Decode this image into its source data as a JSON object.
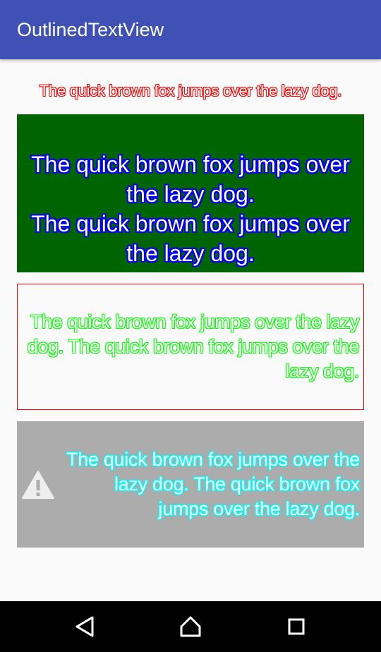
{
  "app": {
    "title": "OutlinedTextView"
  },
  "samples": {
    "red_outline": {
      "text": "The quick brown fox jumps over the lazy dog.",
      "outline_color": "#ff0000",
      "fill_color": "#ffffff"
    },
    "blue_outline_on_green": {
      "text": "The quick brown fox jumps over the lazy dog.\nThe quick brown fox jumps over the lazy dog.",
      "background_color": "#006400",
      "outline_color": "#0000ee",
      "fill_color": "#ffffff"
    },
    "green_outline_bordered": {
      "text": "The quick brown fox jumps over the lazy dog. The quick brown fox jumps over the lazy dog.",
      "border_color": "#ff0000",
      "outline_color": "#00ff00",
      "fill_color": "#ffffff"
    },
    "cyan_glow_with_icon": {
      "icon": "warning-icon",
      "text": "The quick brown fox jumps over the lazy dog. The quick brown fox jumps over the lazy dog.",
      "background_color": "#acacac",
      "outline_color": "#00ffff",
      "fill_color": "#ffffff"
    }
  },
  "navigation": {
    "back_icon": "back-icon",
    "home_icon": "home-icon",
    "recents_icon": "recents-icon"
  },
  "theme": {
    "primary": "#3f51b5",
    "background": "#fafafa",
    "navbar": "#000000"
  }
}
